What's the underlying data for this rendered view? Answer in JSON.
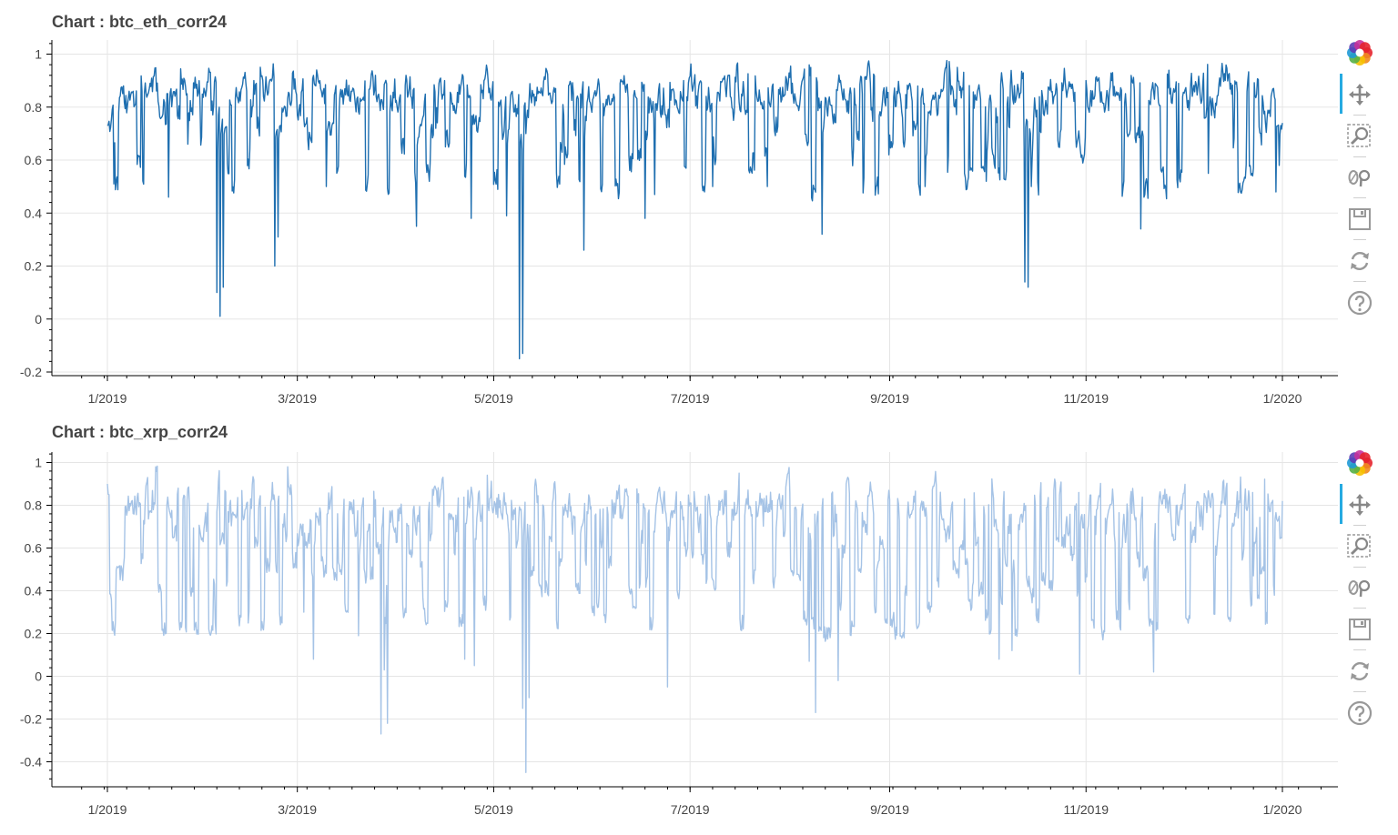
{
  "colors": {
    "series_0": "#1f6fb0",
    "series_1": "#a5c3e6",
    "grid": "#e5e5e5",
    "axis": "#000000"
  },
  "chart_data": [
    {
      "type": "line",
      "title": "Chart : btc_eth_corr24",
      "xlabel": "",
      "ylabel": "",
      "x_range": [
        "2019-01-01",
        "2020-01-14"
      ],
      "ylim": [
        -0.21,
        1.04
      ],
      "grid": true,
      "x_ticks": [
        "1/2019",
        "3/2019",
        "5/2019",
        "7/2019",
        "9/2019",
        "11/2019",
        "1/2020"
      ],
      "y_ticks": [
        "1",
        "0.8",
        "0.6",
        "0.4",
        "0.2",
        "0",
        "-0.2"
      ],
      "series": [
        {
          "color": "#1f6fb0",
          "base": 0.86,
          "noise": 0.045,
          "dip_chance": 0.55,
          "dip_floor": 0.48,
          "seed": 11,
          "x": [
            "2019-01-01",
            "2019-01-03",
            "2019-01-06",
            "2019-01-20",
            "2019-01-26",
            "2019-02-04",
            "2019-02-05",
            "2019-02-06",
            "2019-02-22",
            "2019-02-23",
            "2019-03-10",
            "2019-04-07",
            "2019-04-13",
            "2019-04-24",
            "2019-04-28",
            "2019-05-05",
            "2019-05-09",
            "2019-05-10",
            "2019-05-11",
            "2019-05-29",
            "2019-06-17",
            "2019-06-20",
            "2019-06-29",
            "2019-07-08",
            "2019-07-25",
            "2019-08-11",
            "2019-08-25",
            "2019-09-12",
            "2019-09-22",
            "2019-10-01",
            "2019-10-06",
            "2019-10-13",
            "2019-10-14",
            "2019-10-15",
            "2019-11-01",
            "2019-11-18",
            "2019-11-19",
            "2019-12-09",
            "2019-12-30",
            "2019-12-31",
            "2020-01-01"
          ],
          "y": [
            0.73,
            0.51,
            0.88,
            0.46,
            0.66,
            0.1,
            0.01,
            0.12,
            0.2,
            0.31,
            0.5,
            0.35,
            0.72,
            0.38,
            0.9,
            0.39,
            -0.15,
            -0.13,
            0.7,
            0.26,
            0.38,
            0.47,
            0.9,
            0.5,
            0.5,
            0.32,
            0.92,
            0.5,
            0.95,
            0.52,
            0.9,
            0.14,
            0.12,
            0.5,
            0.9,
            0.34,
            0.46,
            0.55,
            0.48,
            0.58,
            0.74
          ]
        }
      ]
    },
    {
      "type": "line",
      "title": "Chart : btc_xrp_corr24",
      "xlabel": "",
      "ylabel": "",
      "x_range": [
        "2019-01-01",
        "2020-01-14"
      ],
      "ylim": [
        -0.51,
        1.05
      ],
      "grid": true,
      "x_ticks": [
        "1/2019",
        "3/2019",
        "5/2019",
        "7/2019",
        "9/2019",
        "11/2019",
        "1/2020"
      ],
      "y_ticks": [
        "1",
        "0.8",
        "0.6",
        "0.4",
        "0.2",
        "0",
        "-0.2",
        "-0.4"
      ],
      "series": [
        {
          "color": "#a5c3e6",
          "base": 0.8,
          "noise": 0.07,
          "dip_chance": 0.85,
          "dip_floor": 0.2,
          "seed": 29,
          "x": [
            "2019-01-01",
            "2019-01-16",
            "2019-02-26",
            "2019-03-03",
            "2019-03-06",
            "2019-03-20",
            "2019-03-27",
            "2019-03-28",
            "2019-03-29",
            "2019-04-22",
            "2019-04-25",
            "2019-05-08",
            "2019-05-10",
            "2019-05-11",
            "2019-05-12",
            "2019-06-24",
            "2019-08-07",
            "2019-08-09",
            "2019-08-16",
            "2019-10-05",
            "2019-10-09",
            "2019-10-30",
            "2019-11-22",
            "2019-12-11",
            "2019-12-23",
            "2020-01-01"
          ],
          "y": [
            0.9,
            0.98,
            0.98,
            0.3,
            0.08,
            0.19,
            -0.27,
            0.03,
            -0.22,
            0.08,
            0.05,
            0.6,
            -0.15,
            -0.45,
            -0.1,
            -0.05,
            0.07,
            -0.17,
            -0.02,
            0.08,
            0.12,
            0.01,
            0.02,
            0.29,
            0.47,
            0.82
          ]
        }
      ]
    }
  ],
  "toolbar": {
    "tools": [
      "bokeh-logo-icon",
      "pan-icon",
      "box-zoom-icon",
      "wheel-zoom-icon",
      "save-icon",
      "reset-icon",
      "help-icon"
    ]
  }
}
